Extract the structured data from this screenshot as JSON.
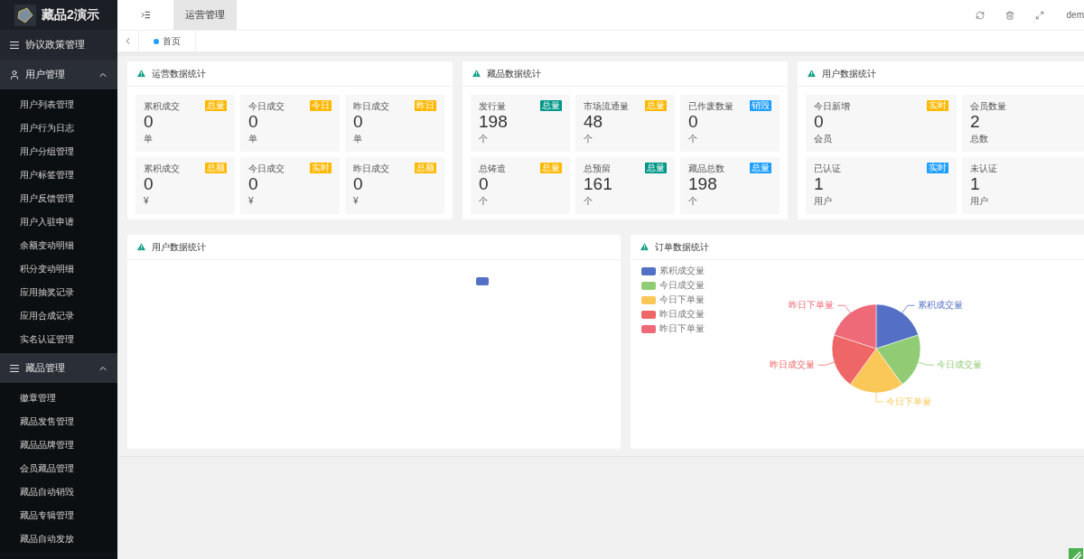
{
  "brand": {
    "title": "藏品2演示"
  },
  "sidebar": [
    {
      "label": "协议政策管理",
      "kind": "list"
    },
    {
      "label": "用户管理",
      "kind": "user",
      "expanded": true,
      "children": [
        "用户列表管理",
        "用户行为日志",
        "用户分组管理",
        "用户标签管理",
        "用户反馈管理",
        "用户入驻申请",
        "余额变动明细",
        "积分变动明细",
        "应用抽奖记录",
        "应用合成记录",
        "实名认证管理"
      ]
    },
    {
      "label": "藏品管理",
      "kind": "list",
      "expanded": true,
      "children": [
        "徽章管理",
        "藏品发售管理",
        "藏品品牌管理",
        "会员藏品管理",
        "藏品自动销毁",
        "藏品专辑管理",
        "藏品自动发放"
      ]
    }
  ],
  "topbar": {
    "tabs": [
      {
        "label": "运营管理",
        "selected": true
      }
    ],
    "user": "dem"
  },
  "pagetabs": [
    {
      "label": "首页",
      "selected": true
    }
  ],
  "stat_cards": [
    {
      "title": "运营数据统计",
      "cells": [
        {
          "label": "累积成交",
          "badge": "总量",
          "color": "#ffb800",
          "value": "0",
          "unit": "单"
        },
        {
          "label": "今日成交",
          "badge": "今日",
          "color": "#ffb800",
          "value": "0",
          "unit": "单"
        },
        {
          "label": "昨日成交",
          "badge": "昨日",
          "color": "#ffb800",
          "value": "0",
          "unit": "单"
        },
        {
          "label": "累积成交",
          "badge": "总额",
          "color": "#ffb800",
          "value": "0",
          "unit": "¥"
        },
        {
          "label": "今日成交",
          "badge": "实时",
          "color": "#ffb800",
          "value": "0",
          "unit": "¥"
        },
        {
          "label": "昨日成交",
          "badge": "总额",
          "color": "#ffb800",
          "value": "0",
          "unit": "¥"
        }
      ]
    },
    {
      "title": "藏品数据统计",
      "cells": [
        {
          "label": "发行量",
          "badge": "总量",
          "color": "#009688",
          "value": "198",
          "unit": "个"
        },
        {
          "label": "市场流通量",
          "badge": "总量",
          "color": "#ffb800",
          "value": "48",
          "unit": "个"
        },
        {
          "label": "已作废数量",
          "badge": "销毁",
          "color": "#1e9fff",
          "value": "0",
          "unit": "个"
        },
        {
          "label": "总铸造",
          "badge": "总量",
          "color": "#ffb800",
          "value": "0",
          "unit": "个"
        },
        {
          "label": "总预留",
          "badge": "总量",
          "color": "#009688",
          "value": "161",
          "unit": "个"
        },
        {
          "label": "藏品总数",
          "badge": "总量",
          "color": "#1e9fff",
          "value": "198",
          "unit": "个"
        }
      ]
    },
    {
      "title": "用户数据统计",
      "cells": [
        {
          "label": "今日新增",
          "badge": "实时",
          "color": "#ffb800",
          "value": "0",
          "unit": "会员"
        },
        {
          "label": "会员数量",
          "value": "2",
          "unit": "总数"
        },
        {
          "label": "已认证",
          "badge": "实时",
          "color": "#1e9fff",
          "value": "1",
          "unit": "用户"
        },
        {
          "label": "未认证",
          "value": "1",
          "unit": "用户"
        }
      ]
    }
  ],
  "chart_cards": [
    {
      "title": "用户数据统计",
      "kind": "empty",
      "legend": [
        {
          "color": "#5470c6"
        }
      ]
    },
    {
      "title": "订单数据统计",
      "kind": "pie",
      "legend": [
        {
          "label": "累积成交量",
          "slice_label": "累积成交量",
          "color": "#5470c6"
        },
        {
          "label": "今日成交量",
          "slice_label": "今日成交量",
          "color": "#91cc75"
        },
        {
          "label": "今日下单量",
          "slice_label": "今日下单量",
          "color": "#fac858"
        },
        {
          "label": "昨日成交量",
          "slice_label": "昨日成交量",
          "color": "#ee6666"
        },
        {
          "label": "昨日下单量",
          "slice_label": "昨日下单量",
          "color": "#ef6a78"
        }
      ]
    }
  ]
}
